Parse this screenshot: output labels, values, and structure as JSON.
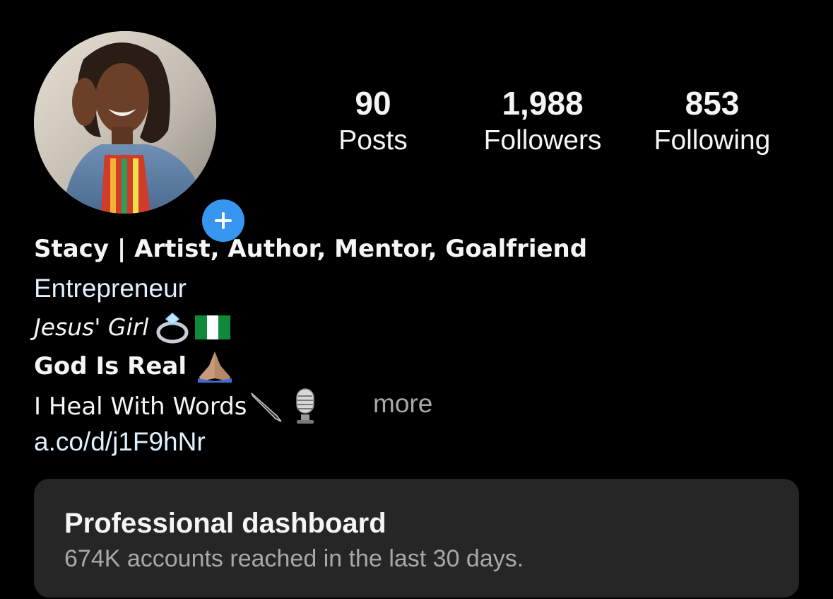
{
  "profile": {
    "avatar_icon": "profile-photo",
    "add_story_icon": "plus-icon",
    "accent_color": "#3797f0"
  },
  "stats": {
    "posts": {
      "count": "90",
      "label": "Posts"
    },
    "followers": {
      "count": "1,988",
      "label": "Followers"
    },
    "following": {
      "count": "853",
      "label": "Following"
    }
  },
  "bio": {
    "name": "Stacy | Artist, Author, Mentor, Goalfriend",
    "category": "Entrepreneur",
    "line1": "Jesus' Girl",
    "line1_emojis": [
      "ring-emoji",
      "nigeria-flag-emoji"
    ],
    "line2": "God Is Real",
    "line2_emojis": [
      "praying-hands-emoji"
    ],
    "line3": "I Heal With Words",
    "line3_emojis": [
      "fountain-pen-emoji",
      "microphone-emoji"
    ],
    "more_label": "more",
    "link": "a.co/d/j1F9hNr"
  },
  "dashboard": {
    "title": "Professional dashboard",
    "subtitle": "674K accounts reached in the last 30 days."
  }
}
